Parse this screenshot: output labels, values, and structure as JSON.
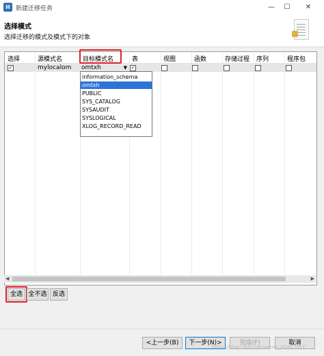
{
  "window": {
    "title": "新建迁移任务",
    "minimize_icon": "minimize-icon",
    "maximize_icon": "maximize-icon",
    "close_icon": "close-icon"
  },
  "header": {
    "title": "选择模式",
    "description": "选择迁移的模式及模式下的对象"
  },
  "table": {
    "columns": [
      "选择",
      "源模式名",
      "目标模式名",
      "表",
      "视图",
      "函数",
      "存储过程",
      "序列",
      "程序包"
    ],
    "rows": [
      {
        "selected": true,
        "source_schema": "mylocalom",
        "target_schema": "omtxh",
        "table": true,
        "view": false,
        "function": false,
        "procedure": false,
        "sequence": false,
        "package": false
      }
    ]
  },
  "dropdown": {
    "options": [
      "information_schema",
      "omtxh",
      "PUBLIC",
      "SYS_CATALOG",
      "SYSAUDIT",
      "SYSLOGICAL",
      "XLOG_RECORD_READ"
    ],
    "selected": "omtxh"
  },
  "selection_buttons": {
    "select_all": "全选",
    "select_none": "全不选",
    "invert": "反选"
  },
  "footer": {
    "back": "<上一步(B)",
    "next": "下一步(N)>",
    "finish": "完成(F)",
    "cancel": "取消"
  },
  "watermark": "https://blog.csdn.net/weixin_41817957",
  "colors": {
    "highlight": "#e0202a",
    "selection": "#2e74d6"
  }
}
